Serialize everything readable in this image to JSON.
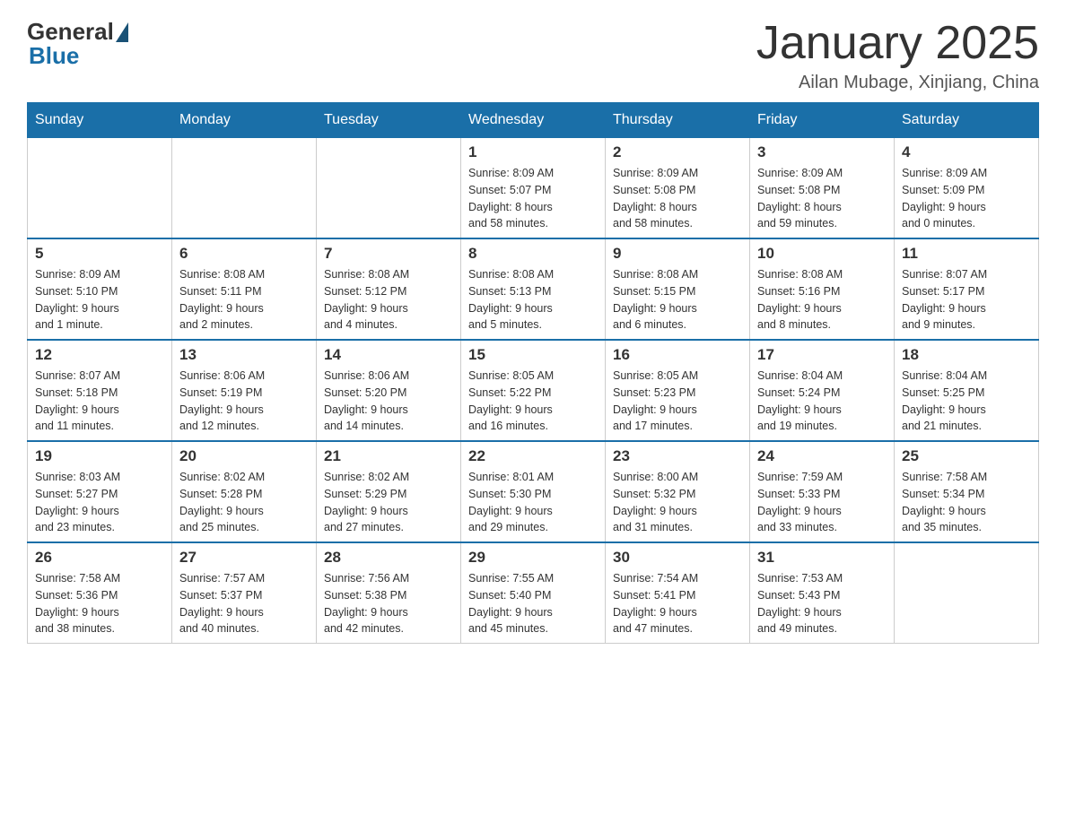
{
  "header": {
    "logo": {
      "general": "General",
      "blue": "Blue"
    },
    "title": "January 2025",
    "location": "Ailan Mubage, Xinjiang, China"
  },
  "weekdays": [
    "Sunday",
    "Monday",
    "Tuesday",
    "Wednesday",
    "Thursday",
    "Friday",
    "Saturday"
  ],
  "weeks": [
    [
      {
        "day": "",
        "info": ""
      },
      {
        "day": "",
        "info": ""
      },
      {
        "day": "",
        "info": ""
      },
      {
        "day": "1",
        "info": "Sunrise: 8:09 AM\nSunset: 5:07 PM\nDaylight: 8 hours\nand 58 minutes."
      },
      {
        "day": "2",
        "info": "Sunrise: 8:09 AM\nSunset: 5:08 PM\nDaylight: 8 hours\nand 58 minutes."
      },
      {
        "day": "3",
        "info": "Sunrise: 8:09 AM\nSunset: 5:08 PM\nDaylight: 8 hours\nand 59 minutes."
      },
      {
        "day": "4",
        "info": "Sunrise: 8:09 AM\nSunset: 5:09 PM\nDaylight: 9 hours\nand 0 minutes."
      }
    ],
    [
      {
        "day": "5",
        "info": "Sunrise: 8:09 AM\nSunset: 5:10 PM\nDaylight: 9 hours\nand 1 minute."
      },
      {
        "day": "6",
        "info": "Sunrise: 8:08 AM\nSunset: 5:11 PM\nDaylight: 9 hours\nand 2 minutes."
      },
      {
        "day": "7",
        "info": "Sunrise: 8:08 AM\nSunset: 5:12 PM\nDaylight: 9 hours\nand 4 minutes."
      },
      {
        "day": "8",
        "info": "Sunrise: 8:08 AM\nSunset: 5:13 PM\nDaylight: 9 hours\nand 5 minutes."
      },
      {
        "day": "9",
        "info": "Sunrise: 8:08 AM\nSunset: 5:15 PM\nDaylight: 9 hours\nand 6 minutes."
      },
      {
        "day": "10",
        "info": "Sunrise: 8:08 AM\nSunset: 5:16 PM\nDaylight: 9 hours\nand 8 minutes."
      },
      {
        "day": "11",
        "info": "Sunrise: 8:07 AM\nSunset: 5:17 PM\nDaylight: 9 hours\nand 9 minutes."
      }
    ],
    [
      {
        "day": "12",
        "info": "Sunrise: 8:07 AM\nSunset: 5:18 PM\nDaylight: 9 hours\nand 11 minutes."
      },
      {
        "day": "13",
        "info": "Sunrise: 8:06 AM\nSunset: 5:19 PM\nDaylight: 9 hours\nand 12 minutes."
      },
      {
        "day": "14",
        "info": "Sunrise: 8:06 AM\nSunset: 5:20 PM\nDaylight: 9 hours\nand 14 minutes."
      },
      {
        "day": "15",
        "info": "Sunrise: 8:05 AM\nSunset: 5:22 PM\nDaylight: 9 hours\nand 16 minutes."
      },
      {
        "day": "16",
        "info": "Sunrise: 8:05 AM\nSunset: 5:23 PM\nDaylight: 9 hours\nand 17 minutes."
      },
      {
        "day": "17",
        "info": "Sunrise: 8:04 AM\nSunset: 5:24 PM\nDaylight: 9 hours\nand 19 minutes."
      },
      {
        "day": "18",
        "info": "Sunrise: 8:04 AM\nSunset: 5:25 PM\nDaylight: 9 hours\nand 21 minutes."
      }
    ],
    [
      {
        "day": "19",
        "info": "Sunrise: 8:03 AM\nSunset: 5:27 PM\nDaylight: 9 hours\nand 23 minutes."
      },
      {
        "day": "20",
        "info": "Sunrise: 8:02 AM\nSunset: 5:28 PM\nDaylight: 9 hours\nand 25 minutes."
      },
      {
        "day": "21",
        "info": "Sunrise: 8:02 AM\nSunset: 5:29 PM\nDaylight: 9 hours\nand 27 minutes."
      },
      {
        "day": "22",
        "info": "Sunrise: 8:01 AM\nSunset: 5:30 PM\nDaylight: 9 hours\nand 29 minutes."
      },
      {
        "day": "23",
        "info": "Sunrise: 8:00 AM\nSunset: 5:32 PM\nDaylight: 9 hours\nand 31 minutes."
      },
      {
        "day": "24",
        "info": "Sunrise: 7:59 AM\nSunset: 5:33 PM\nDaylight: 9 hours\nand 33 minutes."
      },
      {
        "day": "25",
        "info": "Sunrise: 7:58 AM\nSunset: 5:34 PM\nDaylight: 9 hours\nand 35 minutes."
      }
    ],
    [
      {
        "day": "26",
        "info": "Sunrise: 7:58 AM\nSunset: 5:36 PM\nDaylight: 9 hours\nand 38 minutes."
      },
      {
        "day": "27",
        "info": "Sunrise: 7:57 AM\nSunset: 5:37 PM\nDaylight: 9 hours\nand 40 minutes."
      },
      {
        "day": "28",
        "info": "Sunrise: 7:56 AM\nSunset: 5:38 PM\nDaylight: 9 hours\nand 42 minutes."
      },
      {
        "day": "29",
        "info": "Sunrise: 7:55 AM\nSunset: 5:40 PM\nDaylight: 9 hours\nand 45 minutes."
      },
      {
        "day": "30",
        "info": "Sunrise: 7:54 AM\nSunset: 5:41 PM\nDaylight: 9 hours\nand 47 minutes."
      },
      {
        "day": "31",
        "info": "Sunrise: 7:53 AM\nSunset: 5:43 PM\nDaylight: 9 hours\nand 49 minutes."
      },
      {
        "day": "",
        "info": ""
      }
    ]
  ]
}
